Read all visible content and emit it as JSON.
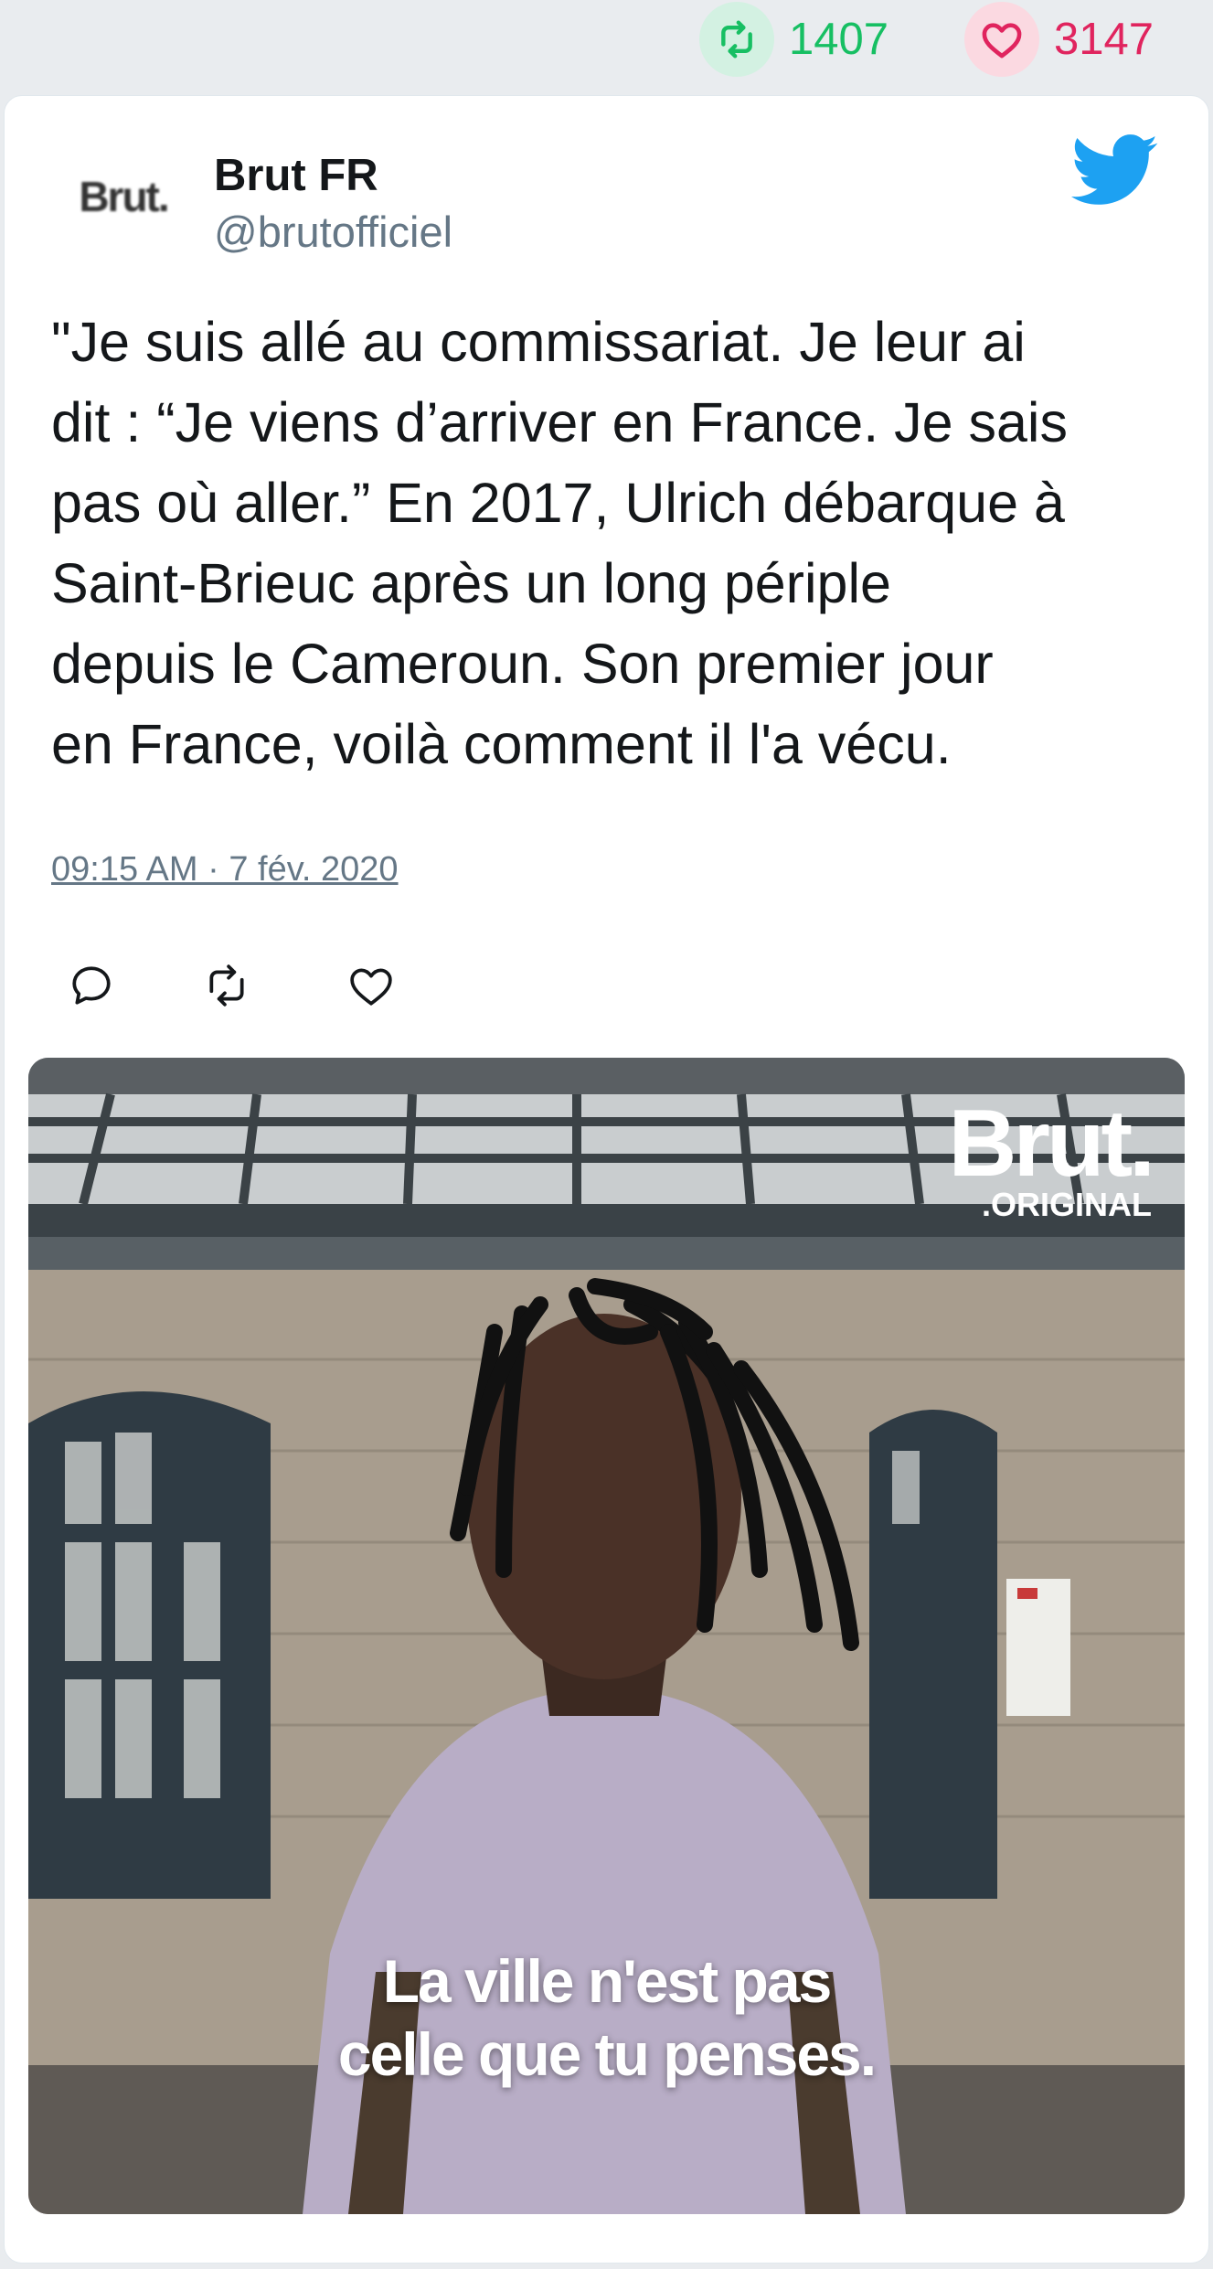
{
  "stats": {
    "retweets": "1407",
    "likes": "3147",
    "retweet_icon": "retweet-icon",
    "like_icon": "heart-icon"
  },
  "tweet": {
    "avatar_text": "Brut.",
    "display_name": "Brut FR",
    "handle": "@brutofficiel",
    "brand_icon": "twitter-bird-icon",
    "lines": [
      "\"Je suis allé au commissariat. Je leur ai",
      "dit : “Je viens d’arriver en France. Je sais",
      "pas où aller.” En 2017, Ulrich débarque à",
      "Saint-Brieuc après un long périple",
      "depuis le Cameroun. Son premier jour",
      "en France, voilà comment il l'a vécu."
    ],
    "timestamp": "09:15 AM · 7 fév. 2020"
  },
  "actions": {
    "reply_icon": "reply-icon",
    "retweet_icon": "retweet-icon",
    "like_icon": "heart-icon"
  },
  "media": {
    "logo_word": "Brut.",
    "logo_sub": ".ORIGINAL",
    "caption_lines": [
      "La ville n'est pas",
      "celle que tu penses."
    ]
  },
  "colors": {
    "retweet": "#17bf63",
    "like": "#e0245e",
    "twitter_blue": "#1da1f2",
    "muted": "#657786",
    "text": "#14171a"
  }
}
